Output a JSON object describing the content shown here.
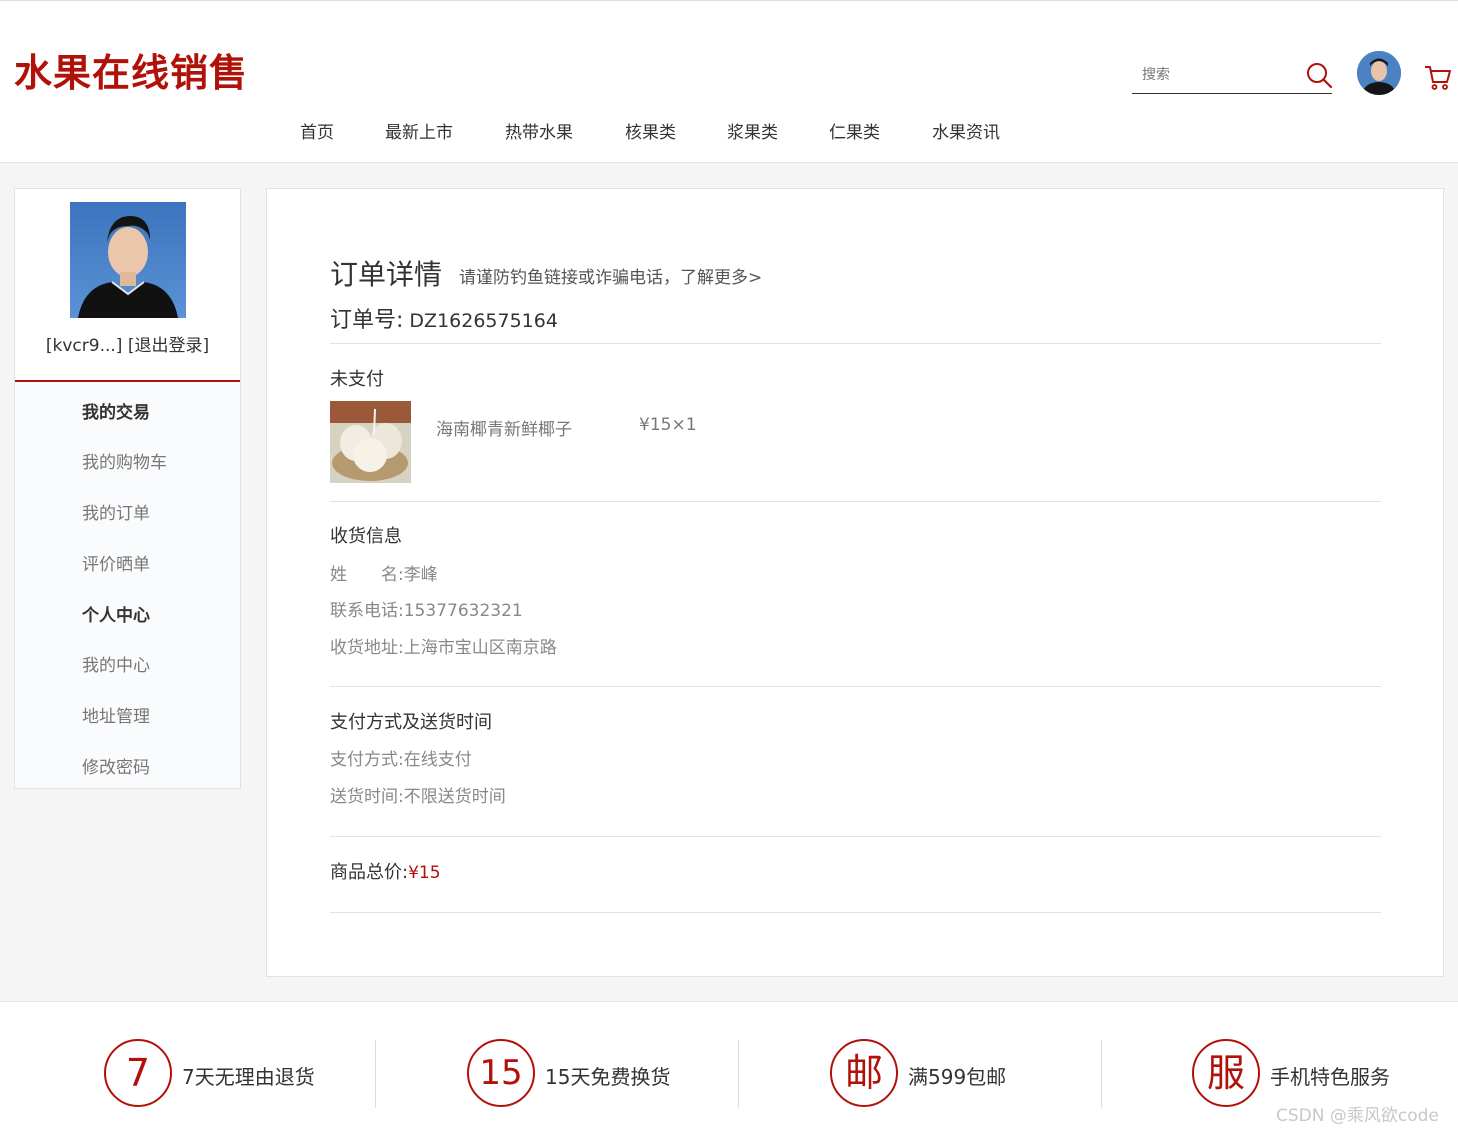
{
  "header": {
    "logo": "水果在线销售",
    "search_placeholder": "搜索",
    "nav": [
      "首页",
      "最新上市",
      "热带水果",
      "核果类",
      "浆果类",
      "仁果类",
      "水果资讯"
    ]
  },
  "sidebar": {
    "username": "[kvcr9...]",
    "logout": "[退出登录]",
    "menu": [
      {
        "label": "我的交易",
        "type": "head"
      },
      {
        "label": "我的购物车",
        "type": "item"
      },
      {
        "label": "我的订单",
        "type": "item"
      },
      {
        "label": "评价晒单",
        "type": "item"
      },
      {
        "label": "个人中心",
        "type": "head"
      },
      {
        "label": "我的中心",
        "type": "item"
      },
      {
        "label": "地址管理",
        "type": "item"
      },
      {
        "label": "修改密码",
        "type": "item"
      }
    ]
  },
  "order": {
    "title": "订单详情",
    "notice": "请谨防钓鱼链接或诈骗电话，了解更多>",
    "no_label": "订单号:",
    "no_value": "DZ1626575164",
    "status": "未支付",
    "product": {
      "name": "海南椰青新鲜椰子",
      "price": "¥15×1"
    },
    "shipping_title": "收货信息",
    "shipping": {
      "name_label": "姓　　名:",
      "name": "李峰",
      "phone_label": "联系电话:",
      "phone": "15377632321",
      "address_label": "收货地址:",
      "address": "上海市宝山区南京路"
    },
    "payment_title": "支付方式及送货时间",
    "payment": {
      "method_label": "支付方式:",
      "method": "在线支付",
      "time_label": "送货时间:",
      "time": "不限送货时间"
    },
    "total_label": "商品总价:",
    "total_value": "¥15"
  },
  "features": [
    {
      "icon": "7",
      "label": "7天无理由退货"
    },
    {
      "icon": "15",
      "label": "15天免费换货"
    },
    {
      "icon": "邮",
      "label": "满599包邮"
    },
    {
      "icon": "服",
      "label": "手机特色服务"
    }
  ],
  "watermark": "CSDN @乘风欲code",
  "colors": {
    "brand": "#b0120a"
  }
}
